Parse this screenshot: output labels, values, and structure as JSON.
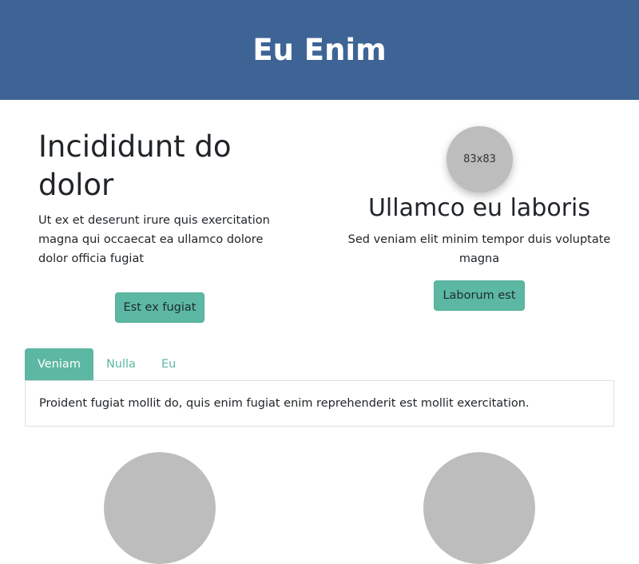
{
  "header": {
    "title": "Eu Enim"
  },
  "left": {
    "heading": "Incididunt do dolor",
    "text": "Ut ex et deserunt irure quis exercitation magna qui occaecat ea ullamco dolore dolor officia fugiat",
    "button_label": "Est ex fugiat"
  },
  "right": {
    "avatar_label": "83x83",
    "heading": "Ullamco eu laboris",
    "text": "Sed veniam elit minim tempor duis voluptate magna",
    "button_label": "Laborum est"
  },
  "tabs": [
    {
      "label": "Veniam",
      "active": true
    },
    {
      "label": "Nulla",
      "active": false
    },
    {
      "label": "Eu",
      "active": false
    }
  ],
  "tab_panel": {
    "text": "Proident fugiat mollit do, quis enim fugiat enim reprehenderit est mollit exercitation."
  },
  "colors": {
    "header_bg": "#3e6496",
    "accent": "#5cb8a2",
    "placeholder_gray": "#bdbdbd"
  }
}
